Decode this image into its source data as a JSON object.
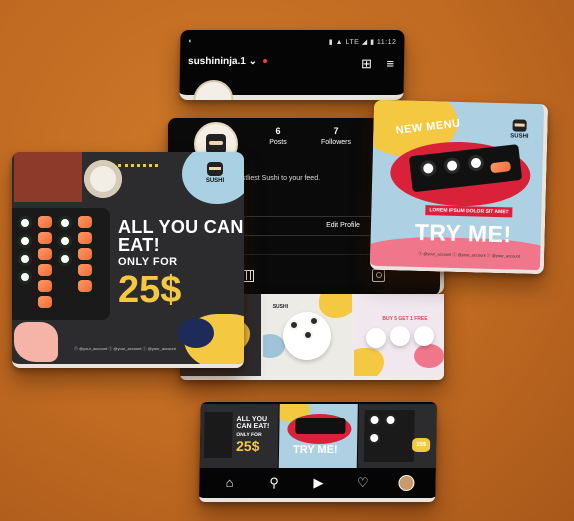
{
  "top_panel": {
    "status_left": "◐",
    "status_right": "▮ ▲ LTE ◢ ▮ 11:12",
    "username": "sushininja.1",
    "username_chevron": "⌄",
    "new_post_icon": "⊞",
    "menu_icon": "≡"
  },
  "profile": {
    "stats": [
      {
        "num": "6",
        "label": "Posts"
      },
      {
        "num": "7",
        "label": "Followers"
      }
    ],
    "bio": "...stliest Sushi to your feed.",
    "edit_label": "Edit Profile"
  },
  "big_card": {
    "logo_text": "SUSHI",
    "headline": "ALL YOU CAN EAT!",
    "only_for": "ONLY FOR",
    "price": "25$",
    "socials": "ⓕ @your_account   ⓣ @your_account   ⓘ @your_account"
  },
  "menu_card": {
    "new_menu": "NEW MENU",
    "logo_text": "SUSHI",
    "lorem": "LOREM IPSUM DOLOR SIT AMET",
    "try_me": "TRY ME!",
    "socials": "ⓕ @your_account  ⓣ @your_account  ⓘ @your_account"
  },
  "grid_tiles": {
    "t2_label": "SUSHI",
    "t3_label": "BUY 5 GET 1 FREE"
  },
  "bottom_phone": {
    "th1_head": "ALL YOU CAN EAT!",
    "th1_only": "ONLY FOR",
    "th1_price": "25$",
    "th2_try": "TRY ME!",
    "th3_price": "15$",
    "nav": {
      "home": "⌂",
      "search": "⚲",
      "reels": "▶",
      "likes": "♡"
    }
  },
  "colors": {
    "background": "#c06a22",
    "accent_yellow": "#f5c842",
    "accent_red": "#d9223a",
    "accent_blue": "#aed0e3",
    "accent_pink": "#f0768c"
  }
}
